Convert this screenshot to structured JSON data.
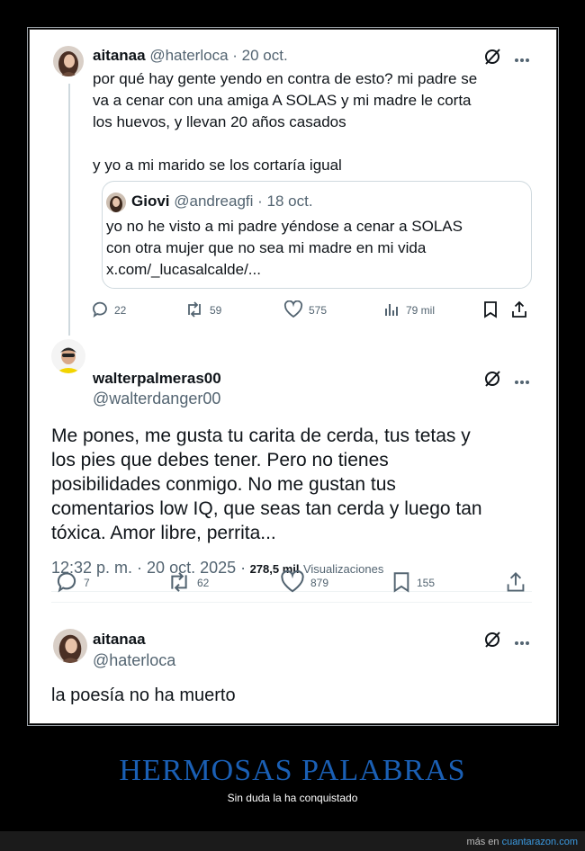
{
  "tweet1": {
    "name": "aitanaa",
    "handle": "@haterloca",
    "date": "· 20 oct.",
    "lines": [
      "por qué hay gente yendo en contra de esto? mi padre se",
      "va a cenar con una amiga A SOLAS y mi madre le corta",
      "los huevos, y llevan 20 años casados",
      "y yo a mi marido se los cortaría igual"
    ],
    "quote": {
      "name": "Giovi",
      "handle": "@andreagfi",
      "date": "· 18 oct.",
      "lines": [
        "yo no he visto a mi padre yéndose a cenar a SOLAS",
        "con otra mujer que no sea mi madre en mi vida",
        "x.com/_lucasalcalde/..."
      ]
    },
    "stats": {
      "replies": "22",
      "retweets": "59",
      "likes": "575",
      "views": "79 mil"
    }
  },
  "tweet2": {
    "name": "walterpalmeras00",
    "handle": "@walterdanger00",
    "lines": [
      "Me pones, me gusta tu carita de cerda, tus tetas y",
      "los pies que debes tener. Pero no tienes",
      "posibilidades conmigo. No me gustan tus",
      "comentarios low IQ, que seas tan cerda y luego tan",
      "tóxica. Amor libre, perrita..."
    ],
    "timestamp": "12:32 p. m. · 20 oct. 2025 ·",
    "views_count": "278,5 mil",
    "views_label": "Visualizaciones",
    "stats": {
      "replies": "7",
      "retweets": "62",
      "likes": "879",
      "bookmarks": "155"
    }
  },
  "tweet3": {
    "name": "aitanaa",
    "handle": "@haterloca",
    "text": "la poesía no ha muerto"
  },
  "caption": {
    "title": "HERMOSAS PALABRAS",
    "subtitle": "Sin duda la ha conquistado"
  },
  "footer": {
    "prefix": "más en",
    "site": "cuantarazon.com"
  },
  "colors": {
    "caption_title": "#1a5fb4",
    "link": "#3b9ae1",
    "muted": "#536471"
  },
  "icons": [
    "grok-icon",
    "more-icon",
    "reply-icon",
    "retweet-icon",
    "like-icon",
    "views-icon",
    "bookmark-icon",
    "share-icon"
  ]
}
